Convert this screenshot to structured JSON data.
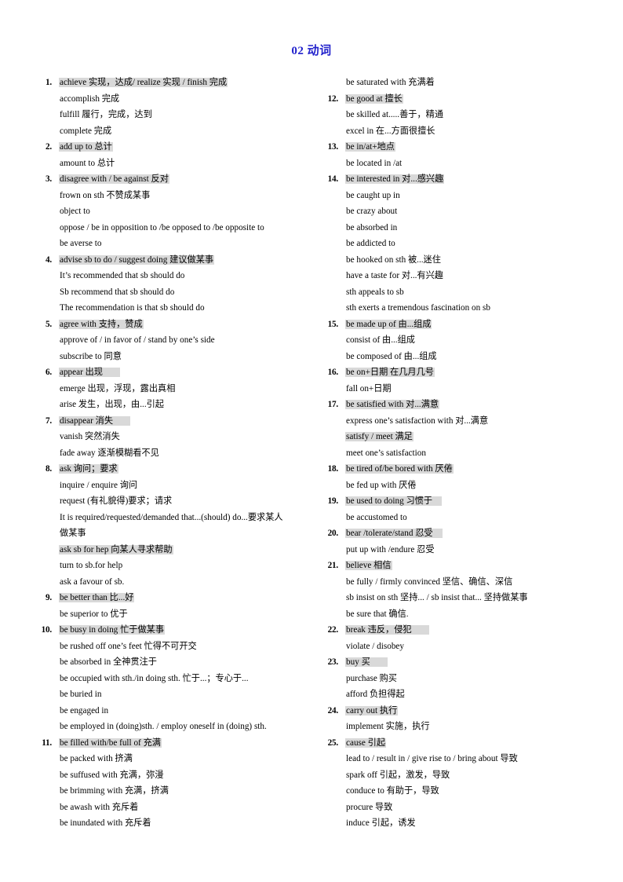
{
  "document": {
    "title": "02  动词",
    "title_color": "#2222cc",
    "highlight_color": "#d9d9d9"
  },
  "left_column": [
    {
      "number": "1.",
      "lines": [
        {
          "text": "achieve  实现，达成/ realize  实现  / finish  完成",
          "highlight": true
        },
        {
          "text": "accomplish  完成",
          "highlight": false
        },
        {
          "text": "fulfill  履行，完成，达到",
          "highlight": false
        },
        {
          "text": "complete  完成",
          "highlight": false
        }
      ]
    },
    {
      "number": "2.",
      "lines": [
        {
          "text": "add up to  总计",
          "highlight": true
        },
        {
          "text": "amount to  总计",
          "highlight": false
        }
      ]
    },
    {
      "number": "3.",
      "lines": [
        {
          "text": "disagree with / be against    反对",
          "highlight": true
        },
        {
          "text": "frown on sth  不赞成某事",
          "highlight": false
        },
        {
          "text": "object to",
          "highlight": false
        },
        {
          "text": "oppose / be in opposition to /be opposed to /be opposite to",
          "highlight": false
        },
        {
          "text": "be averse to",
          "highlight": false
        }
      ]
    },
    {
      "number": "4.",
      "lines": [
        {
          "text": "advise sb to do / suggest doing 建议做某事",
          "highlight": true
        },
        {
          "text": "It’s recommended  that sb should do",
          "highlight": false
        },
        {
          "text": "Sb recommend  that sb should do",
          "highlight": false
        },
        {
          "text": "The recommendation  is that sb should do",
          "highlight": false
        }
      ]
    },
    {
      "number": "5.",
      "lines": [
        {
          "text": "agree with    支持，赞成",
          "highlight": true
        },
        {
          "text": "approve of / in favor of / stand by one’s side",
          "highlight": false
        },
        {
          "text": "subscribe to 同意",
          "highlight": false
        }
      ]
    },
    {
      "number": "6.",
      "lines": [
        {
          "text": "appear  出现",
          "highlight": true,
          "pad": true
        },
        {
          "text": "emerge  出现，浮现，露出真相",
          "highlight": false
        },
        {
          "text": "arise  发生，出现，由...引起",
          "highlight": false
        }
      ]
    },
    {
      "number": "7.",
      "lines": [
        {
          "text": "disappear 消失",
          "highlight": true,
          "pad": true
        },
        {
          "text": "vanish  突然消失",
          "highlight": false
        },
        {
          "text": "fade away 逐渐模糊看不见",
          "highlight": false
        }
      ]
    },
    {
      "number": "8.",
      "lines": [
        {
          "text": "ask  询问；要求",
          "highlight": true
        },
        {
          "text": "inquire / enquire 询问",
          "highlight": false
        },
        {
          "text": "request (有礼貌得)要求；请求",
          "highlight": false
        },
        {
          "text": "It is required/requested/demanded  that...(should) do...要求某人",
          "highlight": false
        },
        {
          "text": "做某事",
          "highlight": false
        },
        {
          "text": "ask sb for hep 向某人寻求帮助",
          "highlight": true
        },
        {
          "text": "turn to sb.for help",
          "highlight": false
        },
        {
          "text": "ask a favour of sb.",
          "highlight": false
        }
      ]
    },
    {
      "number": "9.",
      "lines": [
        {
          "text": "be better  than 比...好",
          "highlight": true
        },
        {
          "text": "be superior to 优于",
          "highlight": false
        }
      ]
    },
    {
      "number": "10.",
      "lines": [
        {
          "text": "be busy in doing   忙于做某事",
          "highlight": true
        },
        {
          "text": "be rushed off one’s feet  忙得不可开交",
          "highlight": false
        },
        {
          "text": "be absorbed in  全神贯注于",
          "highlight": false
        },
        {
          "text": "be occupied with sth./in doing sth. 忙于...；专心于...",
          "highlight": false
        },
        {
          "text": "be buried in",
          "highlight": false
        },
        {
          "text": "be engaged in",
          "highlight": false
        },
        {
          "text": "be employed in (doing)sth. / employ oneself in (doing) sth.",
          "highlight": false
        }
      ]
    },
    {
      "number": "11.",
      "lines": [
        {
          "text": "be filled  with/be full of 充满",
          "highlight": true
        },
        {
          "text": "be packed with 挤满",
          "highlight": false
        },
        {
          "text": "be suffused with 充满，弥漫",
          "highlight": false
        },
        {
          "text": "be brimming  with 充满，挤满",
          "highlight": false
        },
        {
          "text": "be awash with 充斥着",
          "highlight": false
        },
        {
          "text": "be inundated with 充斥着",
          "highlight": false
        }
      ]
    }
  ],
  "right_column": [
    {
      "number": "",
      "lines": [
        {
          "text": "be saturated with 充满着",
          "highlight": false
        }
      ]
    },
    {
      "number": "12.",
      "lines": [
        {
          "text": "be good at 擅长",
          "highlight": true
        },
        {
          "text": "be skilled at.....善于，精通",
          "highlight": false
        },
        {
          "text": "excel in  在...方面很擅长",
          "highlight": false
        }
      ]
    },
    {
      "number": "13.",
      "lines": [
        {
          "text": "be in/at+地点",
          "highlight": true
        },
        {
          "text": "be located  in /at",
          "highlight": false
        }
      ]
    },
    {
      "number": "14.",
      "lines": [
        {
          "text": "be interested  in  对...感兴趣",
          "highlight": true
        },
        {
          "text": "be caught up in",
          "highlight": false
        },
        {
          "text": "be crazy about",
          "highlight": false
        },
        {
          "text": "be absorbed in",
          "highlight": false
        },
        {
          "text": "be addicted  to",
          "highlight": false
        },
        {
          "text": "be hooked on sth 被...迷住",
          "highlight": false
        },
        {
          "text": "have a taste for  对...有兴趣",
          "highlight": false
        },
        {
          "text": "sth appeals to sb",
          "highlight": false
        },
        {
          "text": "sth exerts a tremendous  fascination  on sb",
          "highlight": false
        }
      ]
    },
    {
      "number": "15.",
      "lines": [
        {
          "text": "be made up of   由...组成",
          "highlight": true
        },
        {
          "text": "consist of  由...组成",
          "highlight": false
        },
        {
          "text": "be composed of 由...组成",
          "highlight": false
        }
      ]
    },
    {
      "number": "16.",
      "lines": [
        {
          "text": "be on+日期  在几月几号",
          "highlight": true
        },
        {
          "text": "fall on+日期",
          "highlight": false
        }
      ]
    },
    {
      "number": "17.",
      "lines": [
        {
          "text": "be satisfied with   对...满意",
          "highlight": true
        },
        {
          "text": "express one’s satisfaction  with 对...满意",
          "highlight": false
        },
        {
          "text": "satisfy / meet 满足",
          "highlight": true
        },
        {
          "text": "meet one’s satisfaction",
          "highlight": false
        }
      ]
    },
    {
      "number": "18.",
      "lines": [
        {
          "text": "be tired of/be bored with  厌倦",
          "highlight": true
        },
        {
          "text": "be fed up with 厌倦",
          "highlight": false
        }
      ]
    },
    {
      "number": "19.",
      "lines": [
        {
          "text": "be used to doing 习惯于",
          "highlight": true,
          "pad2": true
        },
        {
          "text": "be accustomed  to",
          "highlight": false
        }
      ]
    },
    {
      "number": "20.",
      "lines": [
        {
          "text": "bear /tolerate/stand 忍受",
          "highlight": true,
          "pad2": true
        },
        {
          "text": "put up with /endure  忍受",
          "highlight": false
        }
      ]
    },
    {
      "number": "21.",
      "lines": [
        {
          "text": "believe  相信",
          "highlight": true
        },
        {
          "text": "be fully / firmly convinced  坚信、确信、深信",
          "highlight": false
        },
        {
          "text": "sb insist on sth  坚持... / sb insist that...  坚持做某事",
          "highlight": false
        },
        {
          "text": "be sure that 确信.",
          "highlight": false
        }
      ]
    },
    {
      "number": "22.",
      "lines": [
        {
          "text": "break  违反，侵犯",
          "highlight": true,
          "pad": true
        },
        {
          "text": "violate / disobey",
          "highlight": false
        }
      ]
    },
    {
      "number": "23.",
      "lines": [
        {
          "text": "buy  买",
          "highlight": true,
          "pad": true
        },
        {
          "text": "purchase  购买",
          "highlight": false
        },
        {
          "text": "afford 负担得起",
          "highlight": false
        }
      ]
    },
    {
      "number": "24.",
      "lines": [
        {
          "text": "carry out 执行",
          "highlight": true
        },
        {
          "text": "implement  实施，执行",
          "highlight": false
        }
      ]
    },
    {
      "number": "25.",
      "lines": [
        {
          "text": "cause  引起",
          "highlight": true
        },
        {
          "text": "lead to / result in / give rise to / bring about 导致",
          "highlight": false
        },
        {
          "text": "spark off 引起，激发，导致",
          "highlight": false
        },
        {
          "text": "conduce to 有助于，导致",
          "highlight": false
        },
        {
          "text": "procure 导致",
          "highlight": false
        },
        {
          "text": "induce 引起，诱发",
          "highlight": false
        }
      ]
    }
  ]
}
